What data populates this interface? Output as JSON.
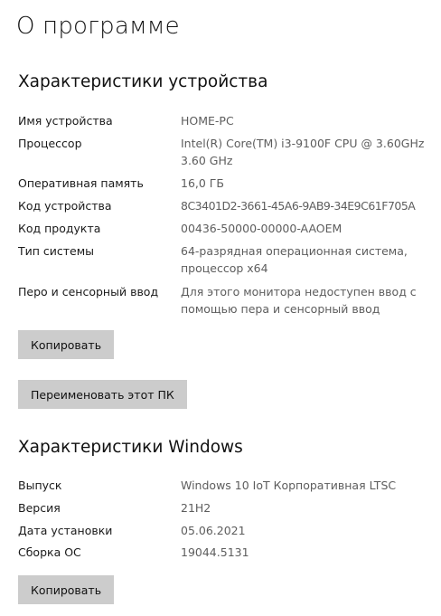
{
  "page_title": "О программе",
  "device_specs": {
    "title": "Характеристики устройства",
    "rows": [
      {
        "label": "Имя устройства",
        "value": "HOME-PC"
      },
      {
        "label": "Процессор",
        "value": "Intel(R) Core(TM) i3-9100F CPU @ 3.60GHz 3.60 GHz"
      },
      {
        "label": "Оперативная память",
        "value": "16,0 ГБ"
      },
      {
        "label": "Код устройства",
        "value": "8C3401D2-3661-45A6-9AB9-34E9C61F705A"
      },
      {
        "label": "Код продукта",
        "value": "00436-50000-00000-AAOEM"
      },
      {
        "label": "Тип системы",
        "value": "64-разрядная операционная система, процессор x64"
      },
      {
        "label": "Перо и сенсорный ввод",
        "value": "Для этого монитора недоступен ввод с помощью пера и сенсорный ввод"
      }
    ],
    "copy_button": "Копировать",
    "rename_button": "Переименовать этот ПК"
  },
  "windows_specs": {
    "title": "Характеристики Windows",
    "rows": [
      {
        "label": "Выпуск",
        "value": "Windows 10 IoT Корпоративная LTSC"
      },
      {
        "label": "Версия",
        "value": "21H2"
      },
      {
        "label": "Дата установки",
        "value": "05.06.2021"
      },
      {
        "label": "Сборка ОС",
        "value": "19044.5131"
      }
    ],
    "copy_button": "Копировать"
  }
}
